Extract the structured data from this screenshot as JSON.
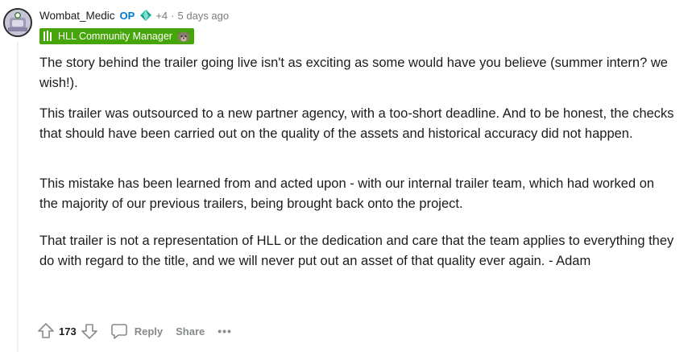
{
  "comment": {
    "author": "Wombat_Medic",
    "op_badge": "OP",
    "award_count": "+4",
    "separator": "·",
    "time_ago": "5 days ago",
    "flair": {
      "text": "HLL Community Manager",
      "color": "#46a508"
    },
    "paragraphs": [
      "The story behind the trailer going live isn't as exciting as some would have you believe (summer intern? we wish!).",
      "This trailer was outsourced to a new partner agency, with a too-short deadline. And to be honest, the checks that should have been carried out on the quality of the assets and historical accuracy did not happen.",
      "This mistake has been learned from and acted upon - with our internal trailer team, which had worked on the majority of our previous trailers, being brought back onto the project.",
      "That trailer is not a representation of HLL or the dedication and care that the team applies to everything they do with regard to the title, and we will never put out an asset of that quality ever again. - Adam"
    ],
    "actions": {
      "score": "173",
      "reply_label": "Reply",
      "share_label": "Share",
      "more_label": "•••"
    }
  },
  "colors": {
    "op": "#0079d3",
    "meta": "#787c7e",
    "action": "#878a8c",
    "text": "#1c1c1c"
  }
}
